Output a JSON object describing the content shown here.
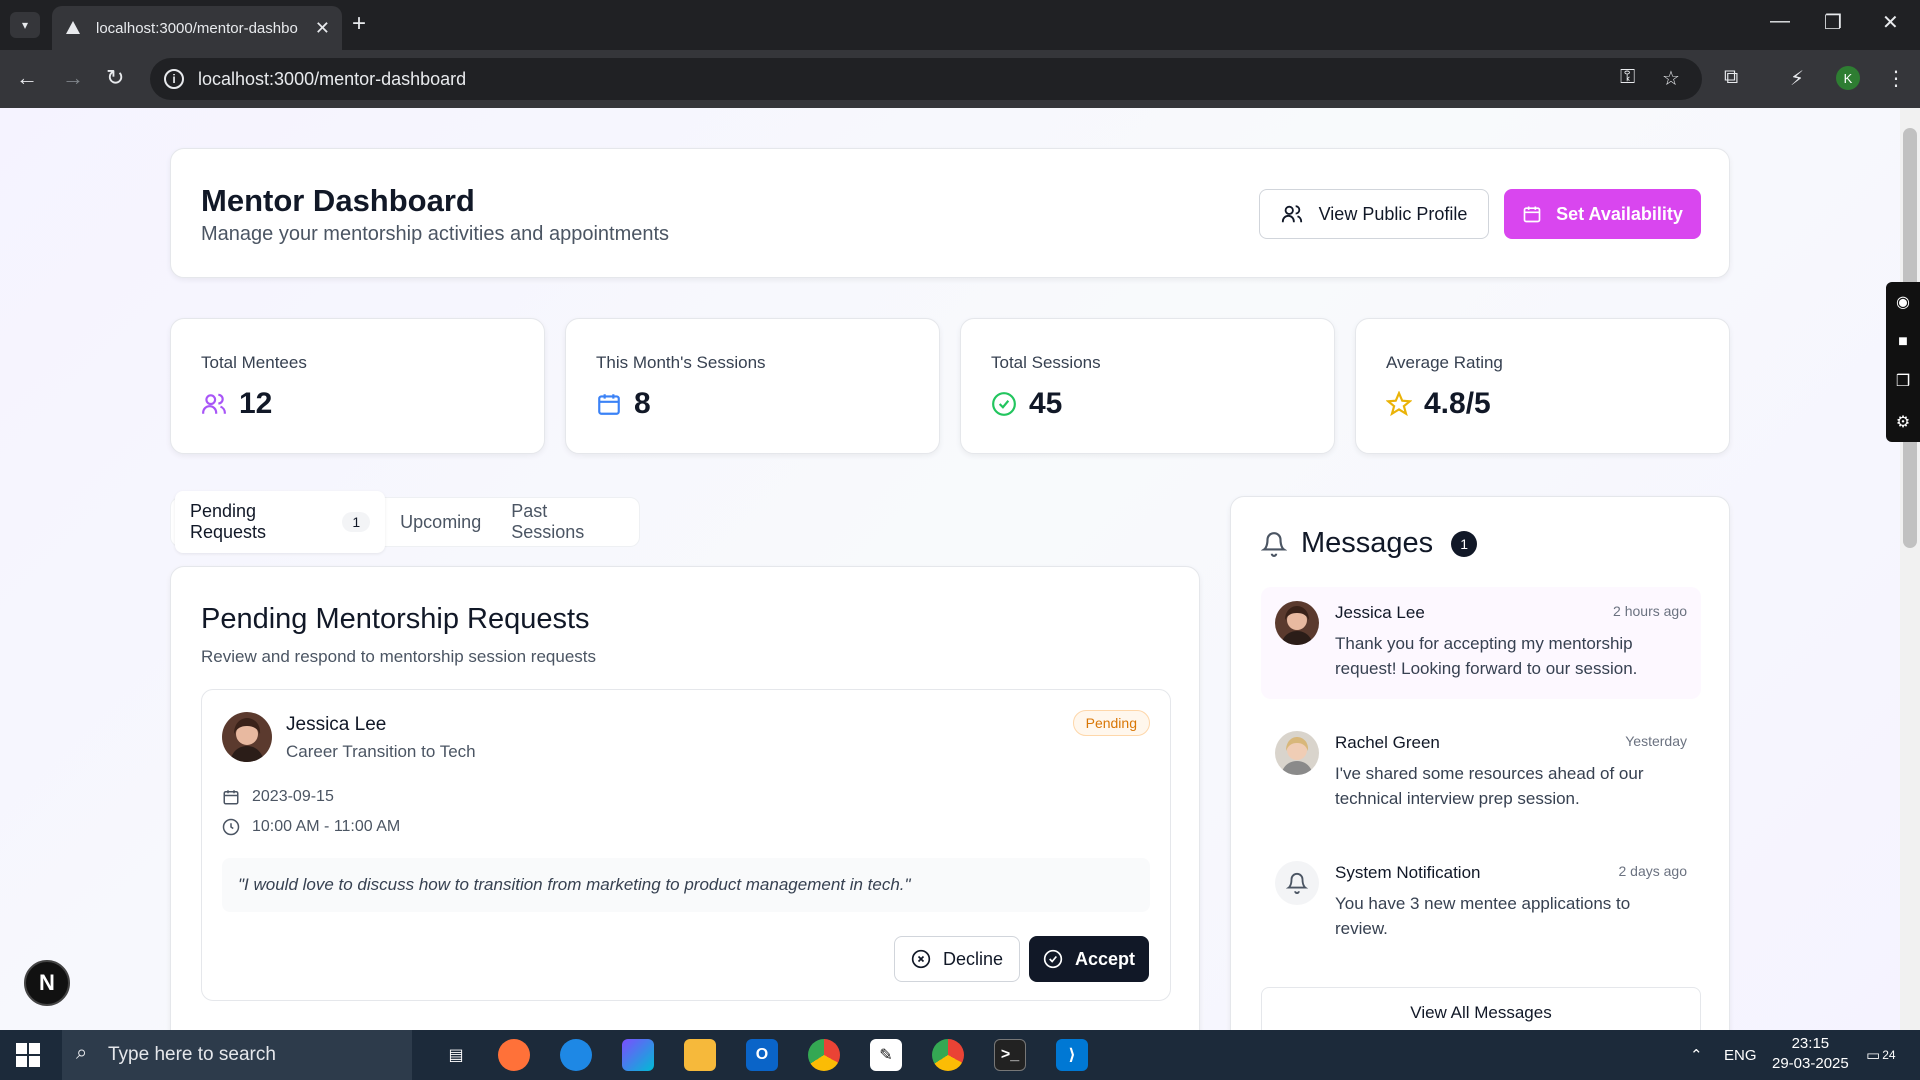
{
  "browser": {
    "tab_title": "localhost:3000/mentor-dashbo",
    "url": "localhost:3000/mentor-dashboard",
    "profile_initial": "K"
  },
  "header": {
    "title": "Mentor Dashboard",
    "subtitle": "Manage your mentorship activities and appointments",
    "view_profile_label": "View Public Profile",
    "set_availability_label": "Set Availability"
  },
  "stats": [
    {
      "label": "Total Mentees",
      "value": "12",
      "icon": "users-icon",
      "color": "#a855f7"
    },
    {
      "label": "This Month's Sessions",
      "value": "8",
      "icon": "calendar-icon",
      "color": "#3b82f6"
    },
    {
      "label": "Total Sessions",
      "value": "45",
      "icon": "check-circle-icon",
      "color": "#22c55e"
    },
    {
      "label": "Average Rating",
      "value": "4.8/5",
      "icon": "star-icon",
      "color": "#eab308"
    }
  ],
  "tabs": [
    {
      "label": "Pending Requests",
      "count": "1",
      "active": true
    },
    {
      "label": "Upcoming"
    },
    {
      "label": "Past Sessions"
    }
  ],
  "requests": {
    "title": "Pending Mentorship Requests",
    "subtitle": "Review and respond to mentorship session requests",
    "items": [
      {
        "name": "Jessica Lee",
        "topic": "Career Transition to Tech",
        "status": "Pending",
        "date": "2023-09-15",
        "time": "10:00 AM - 11:00 AM",
        "message": "\"I would love to discuss how to transition from marketing to product management in tech.\"",
        "decline_label": "Decline",
        "accept_label": "Accept"
      }
    ]
  },
  "messages": {
    "title": "Messages",
    "unread_count": "1",
    "items": [
      {
        "from": "Jessica Lee",
        "when": "2 hours ago",
        "body": "Thank you for accepting my mentorship request! Looking forward to our session.",
        "unread": true
      },
      {
        "from": "Rachel Green",
        "when": "Yesterday",
        "body": "I've shared some resources ahead of our technical interview prep session."
      },
      {
        "from": "System Notification",
        "when": "2 days ago",
        "body": "You have 3 new mentee applications to review."
      }
    ],
    "view_all_label": "View All Messages"
  },
  "taskbar": {
    "search_placeholder": "Type here to search",
    "language": "ENG",
    "time": "23:15",
    "date": "29-03-2025",
    "notifications": "24"
  },
  "colors": {
    "accent": "#d946ef",
    "pending": "#d97706"
  }
}
